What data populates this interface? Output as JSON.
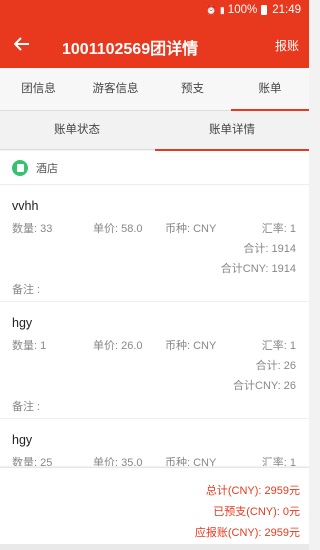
{
  "status_bar": {
    "battery": "100%",
    "time": "21:49",
    "icons": [
      "alarm-icon",
      "signal-icon"
    ]
  },
  "app_bar": {
    "title": "1001102569团详情",
    "action": "报账",
    "back_icon": "arrow-left-icon"
  },
  "tabs": [
    {
      "label": "团信息",
      "active": false
    },
    {
      "label": "游客信息",
      "active": false
    },
    {
      "label": "预支",
      "active": false
    },
    {
      "label": "账单",
      "active": true
    }
  ],
  "sub_tabs": [
    {
      "label": "账单状态",
      "active": false
    },
    {
      "label": "账单详情",
      "active": true
    }
  ],
  "category": {
    "label": "酒店",
    "icon": "document-icon"
  },
  "items": [
    {
      "name": "vvhh",
      "qty": "数量: 33",
      "price": "单价: 58.0",
      "currency": "币种: CNY",
      "rate": "汇率: 1",
      "total": "合计: 1914",
      "total_cny": "合计CNY: 1914",
      "remark": "备注 :"
    },
    {
      "name": "hgy",
      "qty": "数量: 1",
      "price": "单价: 26.0",
      "currency": "币种: CNY",
      "rate": "汇率: 1",
      "total": "合计: 26",
      "total_cny": "合计CNY: 26",
      "remark": "备注 :"
    },
    {
      "name": "hgy",
      "qty": "数量: 25",
      "price": "单价: 35.0",
      "currency": "币种: CNY",
      "rate": "汇率: 1",
      "total": "",
      "total_cny": "",
      "remark": ""
    }
  ],
  "summary": {
    "total": "总计(CNY): 2959元",
    "advanced": "已预支(CNY): 0元",
    "payable": "应报账(CNY): 2959元"
  },
  "colors": {
    "primary": "#e8391e",
    "category_icon": "#37c172"
  }
}
